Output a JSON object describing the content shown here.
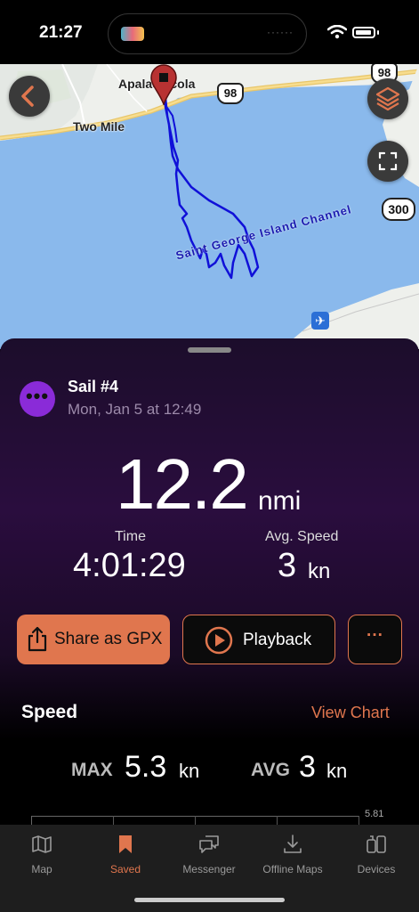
{
  "status_bar": {
    "time": "21:27"
  },
  "map": {
    "labels": {
      "town1": "Apalachicola",
      "town2": "Two Mile",
      "channel": "Saint George Island Channel"
    },
    "road_shields": [
      "98",
      "98",
      "300"
    ]
  },
  "activity": {
    "name": "Sail #4",
    "date": "Mon, Jan 5 at 12:49",
    "distance": "12.2",
    "distance_unit": "nmi",
    "time_label": "Time",
    "time_value": "4:01:29",
    "avg_speed_label": "Avg. Speed",
    "avg_speed_value": "3",
    "avg_speed_unit": "kn"
  },
  "actions": {
    "share_label": "Share as GPX",
    "playback_label": "Playback",
    "more_label": "···"
  },
  "speed": {
    "title": "Speed",
    "view_chart": "View Chart",
    "max_label": "MAX",
    "max_value": "5.3",
    "max_unit": "kn",
    "avg_label": "AVG",
    "avg_value": "3",
    "avg_unit": "kn",
    "chart_top_value": "5.81"
  },
  "tabs": [
    {
      "label": "Map",
      "icon": "map-icon",
      "active": false
    },
    {
      "label": "Saved",
      "icon": "bookmark-icon",
      "active": true
    },
    {
      "label": "Messenger",
      "icon": "chat-icon",
      "active": false
    },
    {
      "label": "Offline Maps",
      "icon": "download-icon",
      "active": false
    },
    {
      "label": "Devices",
      "icon": "devices-icon",
      "active": false
    }
  ],
  "colors": {
    "accent": "#e0764e",
    "track": "#1010d8",
    "activity": "#8a2bd8",
    "water": "#8ab9ec"
  }
}
